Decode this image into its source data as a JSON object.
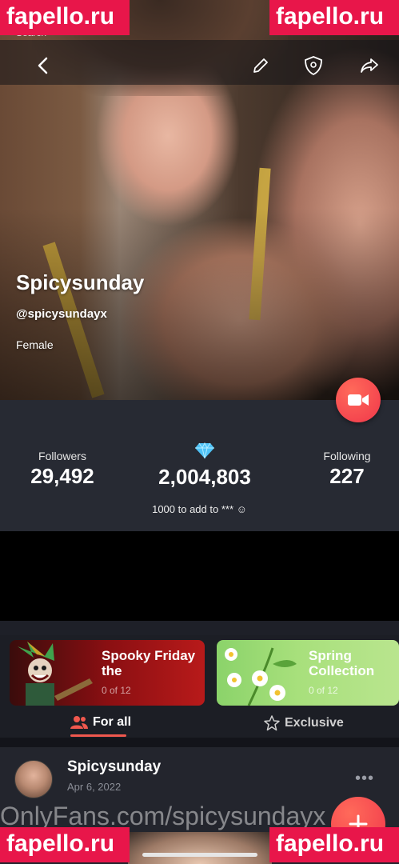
{
  "status_bar": {
    "back_label": "Search"
  },
  "watermarks": {
    "site": "fapello.ru",
    "url_overlay": "OnlyFans.com/spicysundayx"
  },
  "profile": {
    "display_name": "Spicysunday",
    "handle": "@spicysundayx",
    "gender": "Female"
  },
  "stats": {
    "followers_label": "Followers",
    "followers_value": "29,492",
    "gems_value": "2,004,803",
    "following_label": "Following",
    "following_value": "227",
    "gem_note": "1000 to add to *** ☺"
  },
  "collections": [
    {
      "title": "Spooky Friday the",
      "count": "0 of 12"
    },
    {
      "title": "Spring Collection",
      "count": "0 of 12"
    }
  ],
  "tabs": {
    "for_all": "For all",
    "exclusive": "Exclusive"
  },
  "post": {
    "author": "Spicysunday",
    "date": "Apr 6, 2022",
    "more": "•••"
  },
  "colors": {
    "accent": "#f0374a",
    "panel": "#272a33",
    "tab_underline": "#f0584e"
  },
  "icons": [
    "back-icon",
    "edit-icon",
    "shield-icon",
    "share-icon",
    "video-camera-icon",
    "gem-icon",
    "users-icon",
    "star-icon",
    "plus-icon"
  ]
}
